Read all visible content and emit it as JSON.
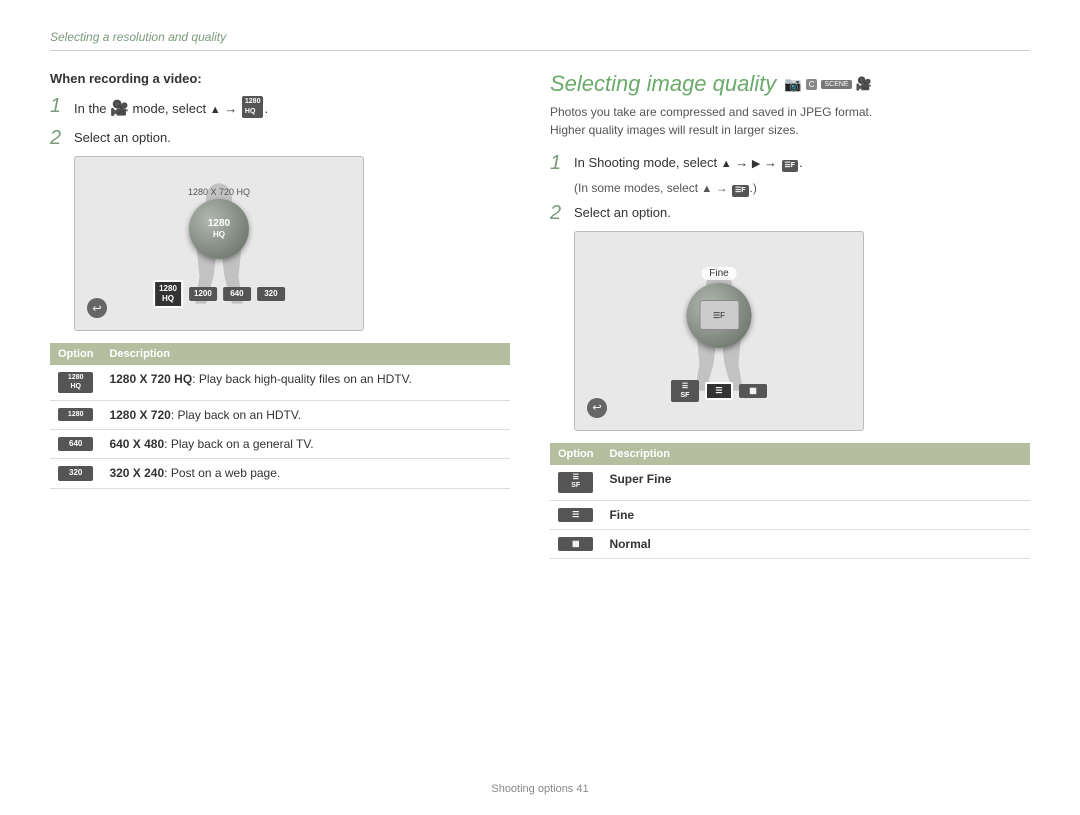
{
  "page": {
    "section_title": "Selecting a resolution and quality",
    "footer_text": "Shooting options",
    "footer_page": "41"
  },
  "left_section": {
    "heading": "When recording a video:",
    "step1_text": "In the",
    "step1_mode": "🎥",
    "step1_cont": "mode, select",
    "step1_arrow": "▲ →",
    "step1_icon": "1280 HQ",
    "step2_text": "Select an option.",
    "preview_label": "1280 X 720 HQ",
    "dial_line1": "1280",
    "dial_line2": "HQ",
    "options": [
      {
        "badge": "1280\nHQ",
        "label": ""
      },
      {
        "badge": "1200",
        "label": ""
      },
      {
        "badge": "640",
        "label": ""
      },
      {
        "badge": "320",
        "label": ""
      }
    ],
    "table_headers": [
      "Option",
      "Description"
    ],
    "table_rows": [
      {
        "icon": "1280\nHQ",
        "desc_bold": "1280 X 720 HQ",
        "desc_text": ": Play back high-quality files on an HDTV."
      },
      {
        "icon": "1280",
        "desc_bold": "1280 X 720",
        "desc_text": ": Play back on an HDTV."
      },
      {
        "icon": "640",
        "desc_bold": "640 X 480",
        "desc_text": ": Play back on a general TV."
      },
      {
        "icon": "320",
        "desc_bold": "320 X 240",
        "desc_text": ": Post on a web page."
      }
    ]
  },
  "right_section": {
    "title": "Selecting image quality",
    "subtitle_line1": "Photos you take are compressed and saved in JPEG format.",
    "subtitle_line2": "Higher quality images will result in larger sizes.",
    "step1_text": "In Shooting mode, select",
    "step1_arrows": "▲ → ▶ →",
    "step1_icon": "☰F",
    "step1_sub": "(In some modes, select ▲ → ☰F.)",
    "step2_text": "Select an option.",
    "fine_label": "Fine",
    "fine_dial_text": "F",
    "table_headers": [
      "Option",
      "Description"
    ],
    "table_rows": [
      {
        "icon": "SF",
        "desc_bold": "Super Fine",
        "desc_text": ""
      },
      {
        "icon": "F",
        "desc_bold": "Fine",
        "desc_text": ""
      },
      {
        "icon": "N",
        "desc_bold": "Normal",
        "desc_text": ""
      }
    ]
  }
}
